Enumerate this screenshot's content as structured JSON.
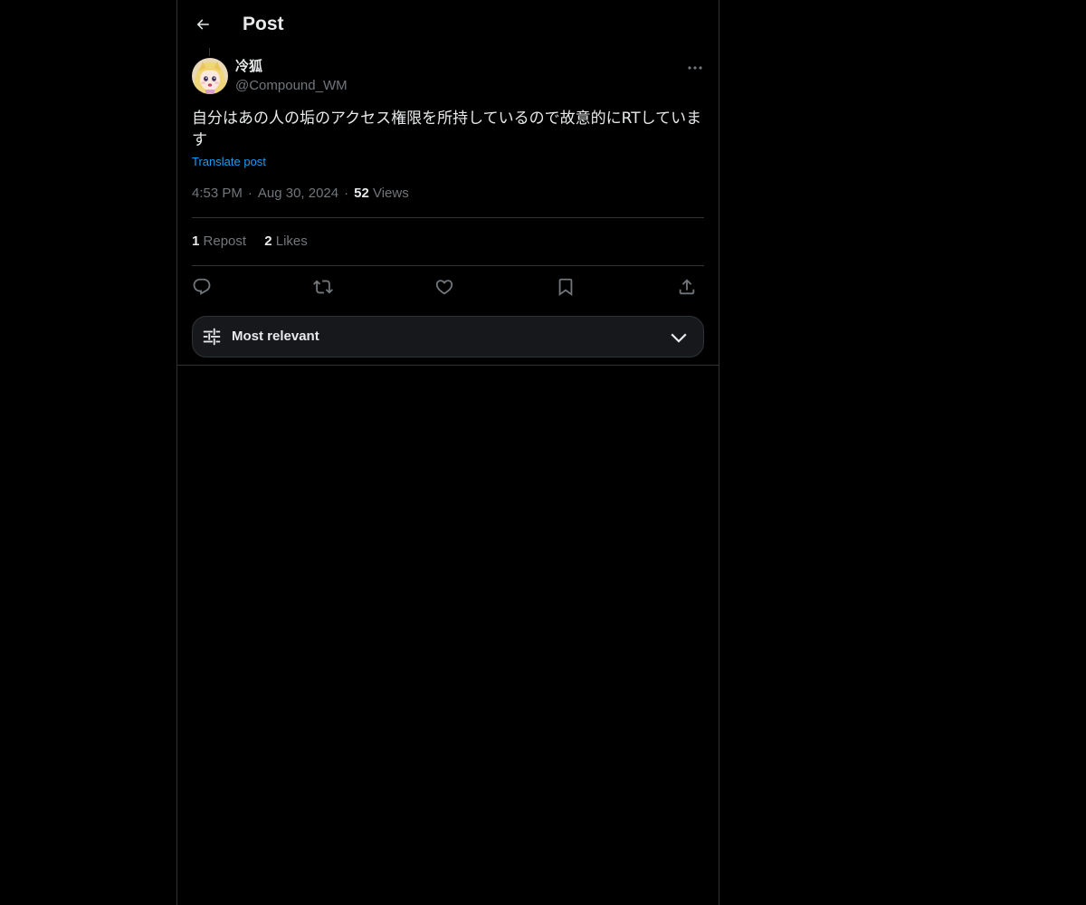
{
  "header": {
    "title": "Post",
    "back_icon": "arrow-left-icon"
  },
  "post": {
    "author": {
      "display_name": "冷狐",
      "handle": "@Compound_WM",
      "avatar_icon": "avatar-image"
    },
    "text": "自分はあの人の垢のアクセス権限を所持しているので故意的にRTしています",
    "translate_label": "Translate post",
    "time": "4:53 PM",
    "separator": "·",
    "date": "Aug 30, 2024",
    "views_count": "52",
    "views_label": "Views"
  },
  "stats": {
    "reposts_count": "1",
    "reposts_label": "Repost",
    "likes_count": "2",
    "likes_label": "Likes"
  },
  "actions": [
    {
      "name": "reply",
      "icon": "speech-bubble-icon"
    },
    {
      "name": "repost",
      "icon": "repost-arrows-icon"
    },
    {
      "name": "like",
      "icon": "heart-icon"
    },
    {
      "name": "bookmark",
      "icon": "bookmark-icon"
    },
    {
      "name": "share",
      "icon": "share-upload-icon"
    }
  ],
  "sort": {
    "label": "Most relevant",
    "icon": "sliders-icon",
    "dropdown_icon": "chevron-down-icon"
  },
  "colors": {
    "background": "#000000",
    "text_primary": "#e7e9ea",
    "text_secondary": "#71767b",
    "link": "#1d9bf0",
    "border": "#2f3336"
  }
}
